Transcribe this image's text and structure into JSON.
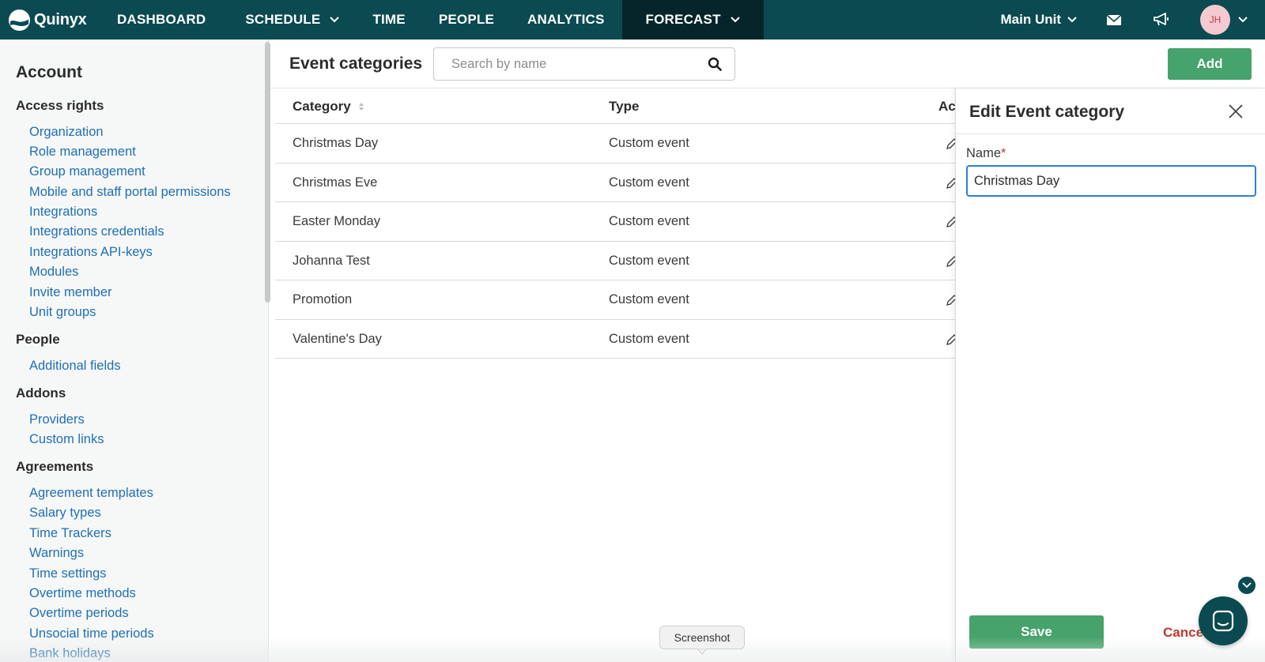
{
  "app": {
    "name": "Quinyx"
  },
  "nav": {
    "items": [
      {
        "label": "DASHBOARD"
      },
      {
        "label": "SCHEDULE"
      },
      {
        "label": "TIME"
      },
      {
        "label": "PEOPLE"
      },
      {
        "label": "ANALYTICS"
      },
      {
        "label": "FORECAST"
      }
    ],
    "unit": "Main Unit",
    "avatar_initials": "JH",
    "icons": [
      "mail-icon",
      "megaphone-icon"
    ]
  },
  "sidebar": {
    "title": "Account",
    "sections": [
      {
        "title": "Access rights",
        "items": [
          "Organization",
          "Role management",
          "Group management",
          "Mobile and staff portal permissions",
          "Integrations",
          "Integrations credentials",
          "Integrations API-keys",
          "Modules",
          "Invite member",
          "Unit groups"
        ]
      },
      {
        "title": "People",
        "items": [
          "Additional fields"
        ]
      },
      {
        "title": "Addons",
        "items": [
          "Providers",
          "Custom links"
        ]
      },
      {
        "title": "Agreements",
        "items": [
          "Agreement templates",
          "Salary types",
          "Time Trackers",
          "Warnings",
          "Time settings",
          "Overtime methods",
          "Overtime periods",
          "Unsocial time periods",
          "Bank holidays"
        ]
      }
    ]
  },
  "main": {
    "title": "Event categories",
    "search_placeholder": "Search by name",
    "add_label": "Add",
    "table": {
      "columns": [
        "Category",
        "Type",
        "Ac"
      ],
      "rows": [
        {
          "category": "Christmas Day",
          "type": "Custom event"
        },
        {
          "category": "Christmas Eve",
          "type": "Custom event"
        },
        {
          "category": "Easter Monday",
          "type": "Custom event"
        },
        {
          "category": "Johanna Test",
          "type": "Custom event"
        },
        {
          "category": "Promotion",
          "type": "Custom event"
        },
        {
          "category": "Valentine's Day",
          "type": "Custom event"
        }
      ]
    }
  },
  "drawer": {
    "title": "Edit Event category",
    "name_label": "Name",
    "required_mark": "*",
    "name_value": "Christmas Day",
    "save_label": "Save",
    "cancel_label": "Cancel"
  },
  "overlay": {
    "tooltip": "Screenshot"
  },
  "colors": {
    "nav_bg": "#0b4a51",
    "nav_active": "#06252a",
    "link": "#1f6fb5",
    "primary_button": "#46a36b",
    "cancel": "#c0392b",
    "focus": "#2f7fd1"
  }
}
